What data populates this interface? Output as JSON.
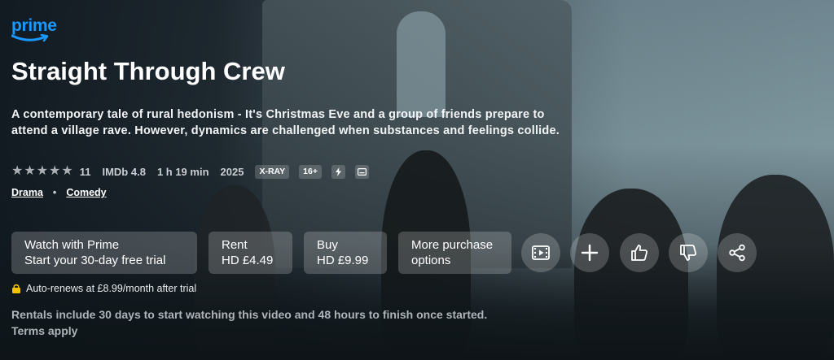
{
  "brand": {
    "name": "prime",
    "color": "#1a98ff"
  },
  "title": "Straight Through Crew",
  "synopsis": "A contemporary tale of rural hedonism - It's Christmas Eve and a group of friends prepare to attend a village rave. However, dynamics are challenged when substances and feelings collide.",
  "meta": {
    "star_rating_out_of_5": 5,
    "rating_count": "11",
    "imdb": "IMDb 4.8",
    "runtime": "1 h 19 min",
    "year": "2025",
    "badges": [
      "X-RAY",
      "16+"
    ],
    "icons": [
      "lightning-icon",
      "subtitles-icon"
    ]
  },
  "genres": [
    "Drama",
    "Comedy"
  ],
  "genre_separator": "•",
  "actions": {
    "watch": {
      "line1": "Watch with Prime",
      "line2": "Start your 30-day free trial"
    },
    "rent": {
      "line1": "Rent",
      "line2": "HD £4.49"
    },
    "buy": {
      "line1": "Buy",
      "line2": "HD £9.99"
    },
    "more": {
      "line1": "More purchase",
      "line2": "options"
    },
    "icon_buttons": [
      "trailer-icon",
      "add-icon",
      "thumbs-up-icon",
      "thumbs-down-icon",
      "share-icon"
    ]
  },
  "auto_renew": "Auto-renews at £8.99/month after trial",
  "rentals_note": "Rentals include 30 days to start watching this video and 48 hours to finish once started.",
  "terms": "Terms apply"
}
